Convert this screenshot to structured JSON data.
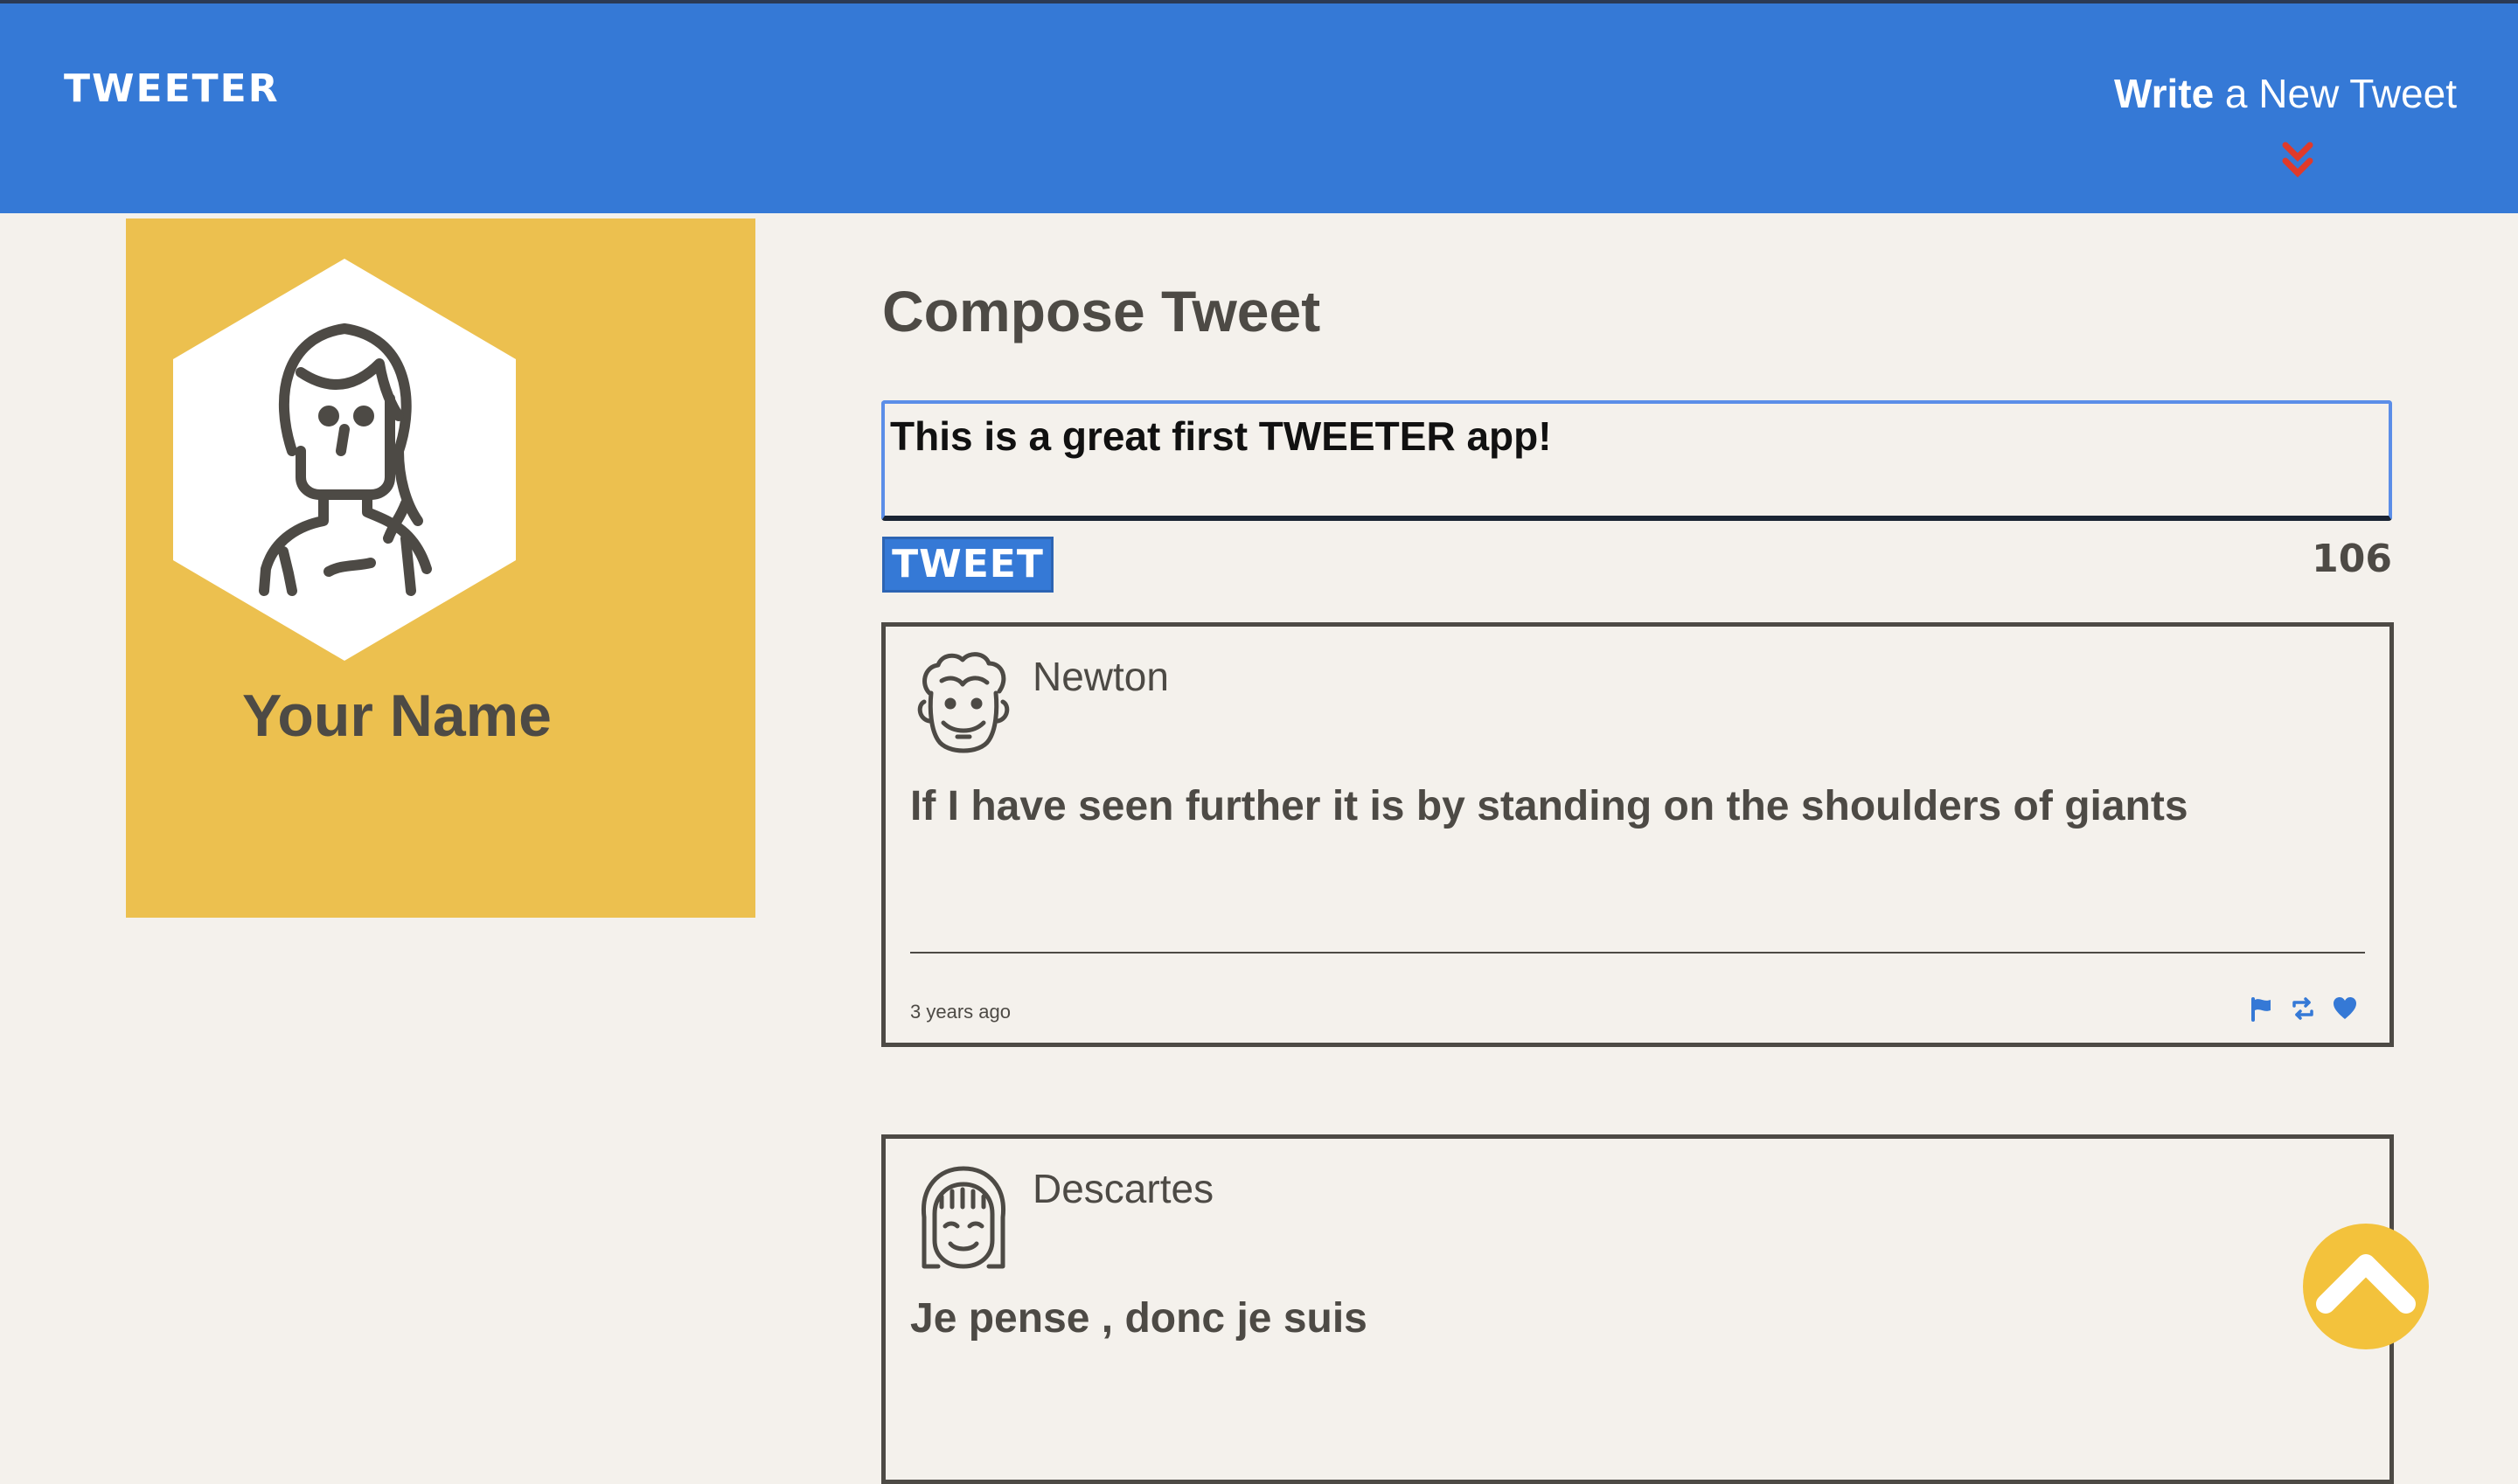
{
  "nav": {
    "brand": "TWEETER",
    "write_bold": "Write",
    "write_rest": " a New Tweet",
    "chevron_color": "#e03a2a"
  },
  "profile": {
    "name": "Your Name",
    "background": "#ecc04f"
  },
  "compose": {
    "title": "Compose Tweet",
    "text": "This is a great first TWEETER app!",
    "button_label": "TWEET",
    "counter": "106"
  },
  "tweets": [
    {
      "handle": "Newton",
      "content": "If I have seen further it is by standing on the shoulders of giants",
      "age": "3 years ago",
      "actions": [
        "flag-icon",
        "retweet-icon",
        "heart-icon"
      ]
    },
    {
      "handle": "Descartes",
      "content": "Je pense , donc je suis"
    }
  ],
  "colors": {
    "nav": "#3579d6",
    "accent_icons": "#3579d6",
    "page_bg": "#f4f1ec",
    "scroll_button": "#f3c23c"
  }
}
